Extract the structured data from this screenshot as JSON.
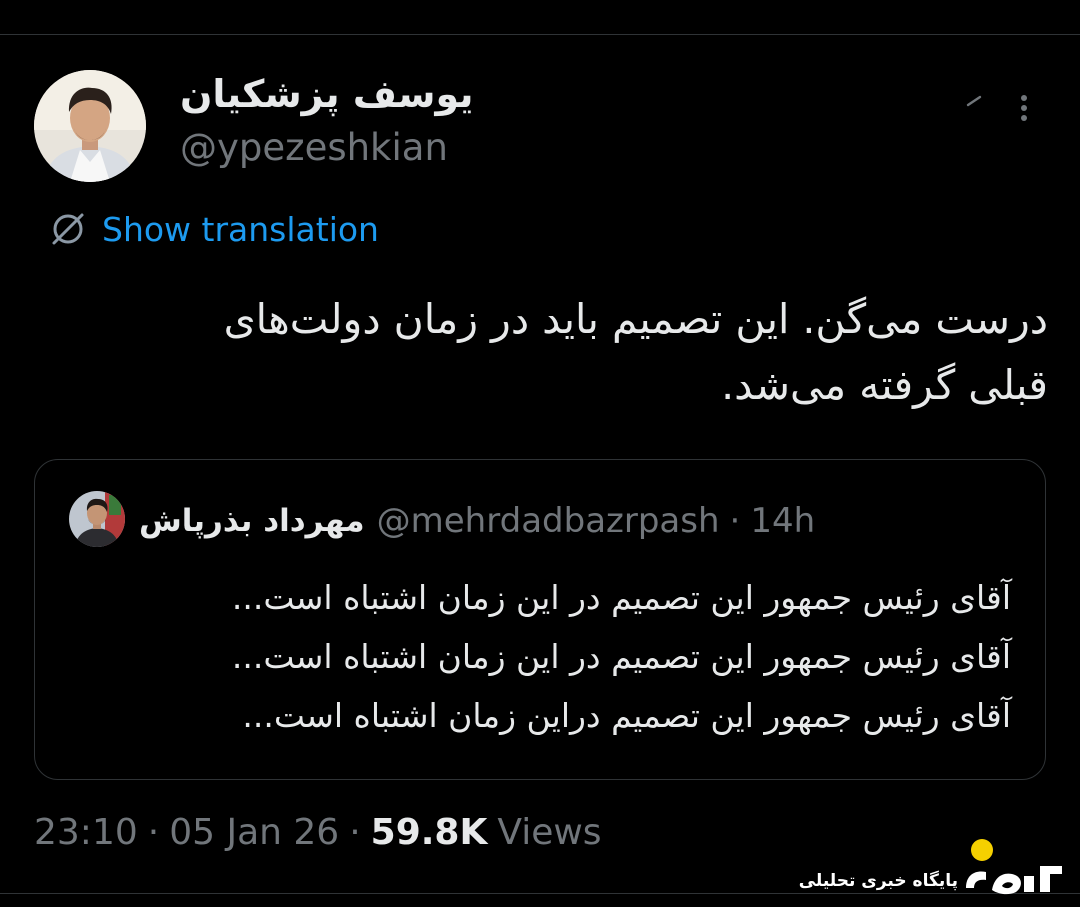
{
  "author": {
    "display_name": "یوسف پزشکیان",
    "handle": "@ypezeshkian",
    "avatar_icon": "profile-photo"
  },
  "header_icons": {
    "grok": "grok-icon",
    "more": "more-dots-icon"
  },
  "translation": {
    "label": "Show translation",
    "icon": "globe-slash-icon"
  },
  "tweet": {
    "lines": [
      "درست می‌گن. این تصمیم باید در زمان دولت‌های",
      "قبلی گرفته می‌شد."
    ]
  },
  "quoted": {
    "display_name": "مهرداد بذرپاش",
    "handle": "@mehrdadbazrpash",
    "separator": "·",
    "time": "14h",
    "lines": [
      "آقای رئیس جمهور این تصمیم در این زمان اشتباه است...",
      "آقای رئیس جمهور این تصمیم در این زمان اشتباه است...",
      "آقای رئیس جمهور این تصمیم دراین زمان اشتباه است..."
    ]
  },
  "meta": {
    "time": "23:10",
    "separator": "·",
    "date": "05 Jan 26",
    "views_count": "59.8K",
    "views_label": "Views"
  },
  "watermark": {
    "caption": "پایگاه خبری تحلیلی",
    "logo_text": "روزنو"
  },
  "colors": {
    "background": "#000000",
    "text": "#e7e9ea",
    "muted": "#71767b",
    "link": "#1d9bf0",
    "border": "#2f3336",
    "watermark_accent": "#f5d000"
  }
}
